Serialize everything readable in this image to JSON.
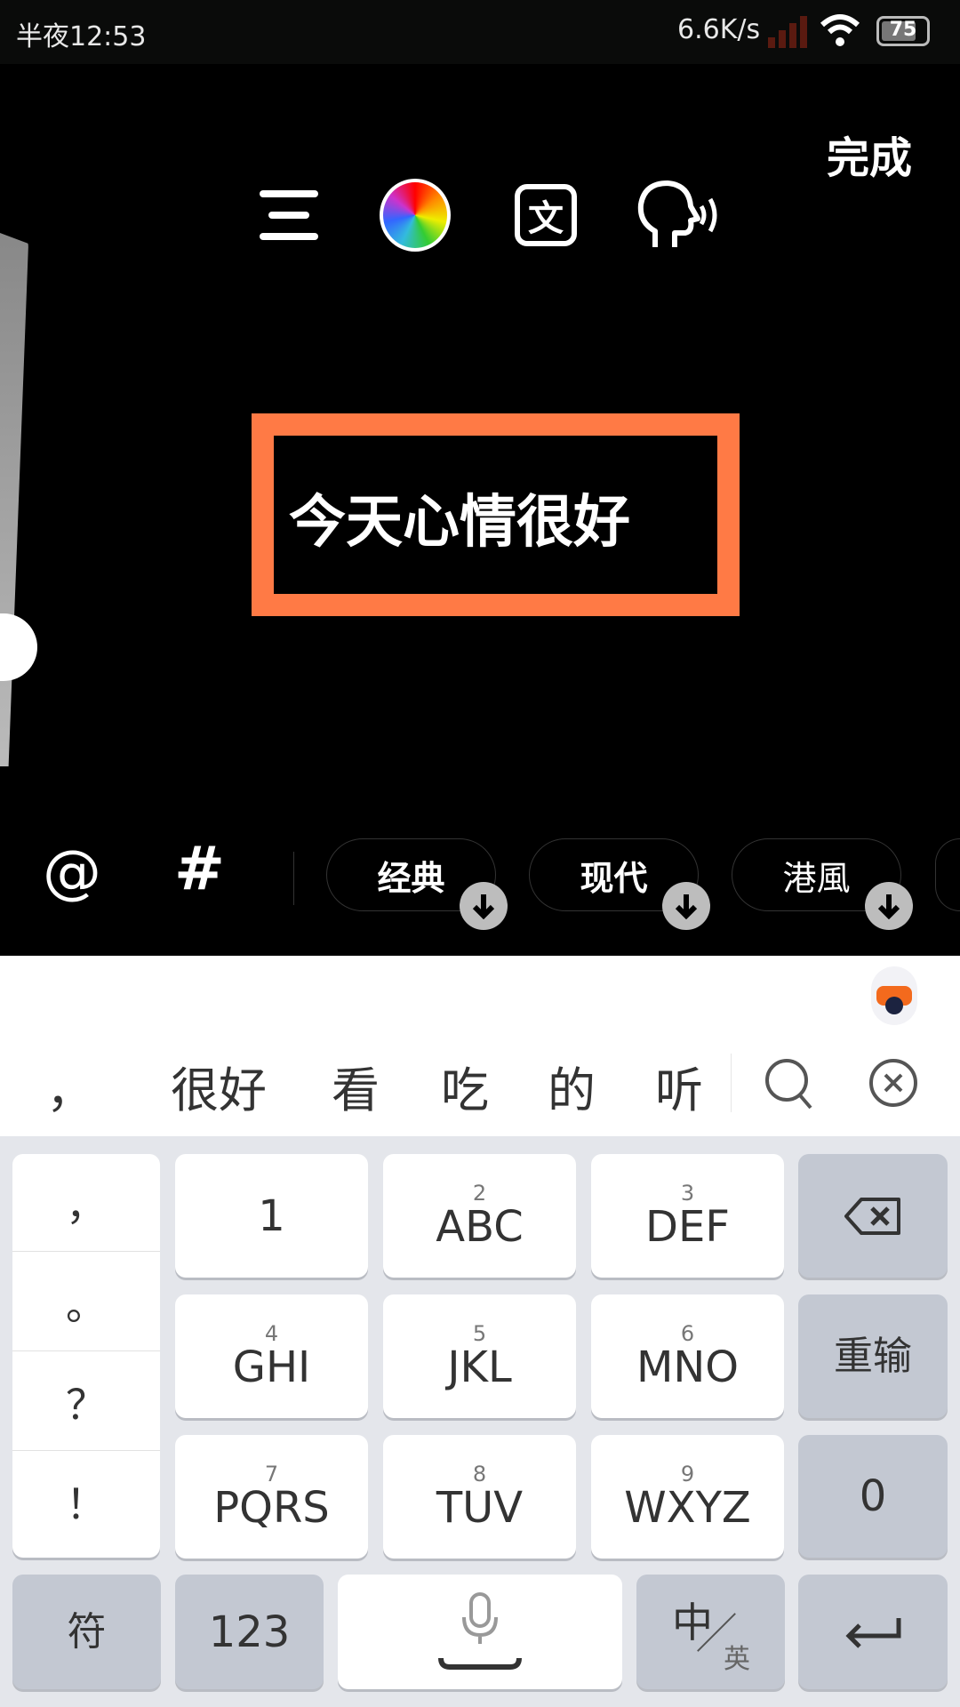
{
  "status": {
    "time": "半夜12:53",
    "net_speed": "6.6K/s",
    "battery": "75"
  },
  "toolbar": {
    "icons": [
      "align-menu-icon",
      "color-wheel-icon",
      "text-style-icon",
      "speech-icon"
    ],
    "done": "完成"
  },
  "canvas": {
    "text": "今天心情很好",
    "frame_color": "#ff7a45"
  },
  "bottom": {
    "at": "@",
    "hash": "#",
    "fonts": [
      "经典",
      "现代",
      "港風"
    ]
  },
  "candidates": {
    "items": [
      "，",
      "很好",
      "看",
      "吃",
      "的",
      "听"
    ]
  },
  "keyboard": {
    "punct": [
      "，",
      "。",
      "？",
      "！"
    ],
    "keys": [
      {
        "n": "",
        "l": "1"
      },
      {
        "n": "2",
        "l": "ABC"
      },
      {
        "n": "3",
        "l": "DEF"
      },
      {
        "n": "4",
        "l": "GHI"
      },
      {
        "n": "5",
        "l": "JKL"
      },
      {
        "n": "6",
        "l": "MNO"
      },
      {
        "n": "7",
        "l": "PQRS"
      },
      {
        "n": "8",
        "l": "TUV"
      },
      {
        "n": "9",
        "l": "WXYZ"
      }
    ],
    "reinput": "重输",
    "zero": "0",
    "symbols": "符",
    "num": "123",
    "lang_main": "中",
    "lang_sub": "英"
  }
}
